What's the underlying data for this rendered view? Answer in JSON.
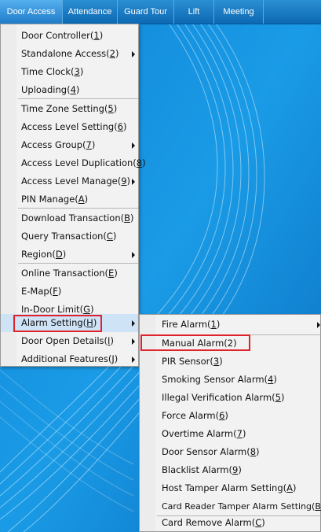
{
  "menubar": {
    "tabs": [
      {
        "label": "Door Access",
        "active": true
      },
      {
        "label": "Attendance"
      },
      {
        "label": "Guard Tour"
      },
      {
        "label": "Lift"
      },
      {
        "label": "Meeting"
      }
    ]
  },
  "main_menu": {
    "items": [
      {
        "text": "Door Controller(",
        "key": "1",
        "end": ")"
      },
      {
        "text": "Standalone Access(",
        "key": "2",
        "end": ")"
      },
      {
        "text": "Time Clock(",
        "key": "3",
        "end": ")"
      },
      {
        "text": "Uploading(",
        "key": "4",
        "end": ")"
      },
      {
        "text": "Time Zone Setting(",
        "key": "5",
        "end": ")"
      },
      {
        "text": "Access Level Setting(",
        "key": "6",
        "end": ")"
      },
      {
        "text": "Access Group(",
        "key": "7",
        "end": ")"
      },
      {
        "text": "Access Level Duplication(",
        "key": "8",
        "end": ")"
      },
      {
        "text": "Access Level Manage(",
        "key": "9",
        "end": ")"
      },
      {
        "text": "PIN Manage(",
        "key": "A",
        "end": ")"
      },
      {
        "text": "Download Transaction(",
        "key": "B",
        "end": ")"
      },
      {
        "text": "Query Transaction(",
        "key": "C",
        "end": ")"
      },
      {
        "text": "Region(",
        "key": "D",
        "end": ")"
      },
      {
        "text": "Online Transaction(",
        "key": "E",
        "end": ")"
      },
      {
        "text": "E-Map(",
        "key": "F",
        "end": ")"
      },
      {
        "text": "In-Door Limit(",
        "key": "G",
        "end": ")"
      },
      {
        "text": "Alarm Setting(",
        "key": "H",
        "end": ")"
      },
      {
        "text": "Door Open Details(",
        "key": "I",
        "end": ")"
      },
      {
        "text": "Additional Features(",
        "key": "J",
        "end": ")"
      }
    ]
  },
  "sub_menu": {
    "items": [
      {
        "text": "Fire Alarm(",
        "key": "1",
        "end": ")"
      },
      {
        "text": "Manual Alarm(",
        "key": "",
        "end": "2)"
      },
      {
        "text": "PIR Sensor(",
        "key": "3",
        "end": ")"
      },
      {
        "text": "Smoking Sensor Alarm(",
        "key": "4",
        "end": ")"
      },
      {
        "text": "Illegal Verification Alarm(",
        "key": "5",
        "end": ")"
      },
      {
        "text": "Force Alarm(",
        "key": "6",
        "end": ")"
      },
      {
        "text": "Overtime Alarm(",
        "key": "7",
        "end": ")"
      },
      {
        "text": "Door Sensor Alarm(",
        "key": "8",
        "end": ")"
      },
      {
        "text": "Blacklist Alarm(",
        "key": "9",
        "end": ")"
      },
      {
        "text": "Host Tamper Alarm Setting(",
        "key": "A",
        "end": ")"
      },
      {
        "text": "Card Reader Tamper Alarm Setting(",
        "key": "B",
        "end": ")"
      },
      {
        "text": "Card Remove Alarm(",
        "key": "C",
        "end": ")"
      }
    ]
  },
  "colors": {
    "accent": "#0c68b3",
    "highlight_box": "#e0232b",
    "selection": "#cfe3f7"
  }
}
